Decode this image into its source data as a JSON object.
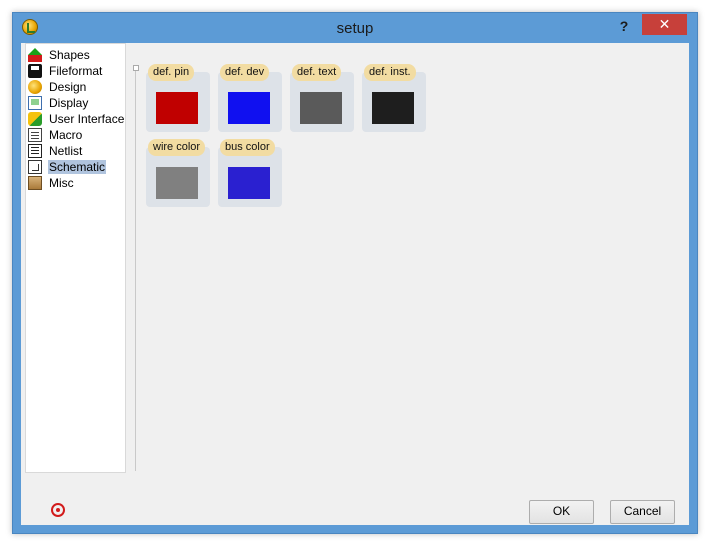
{
  "window": {
    "title": "setup",
    "help_label": "?",
    "close_label": "✕"
  },
  "sidebar": {
    "items": [
      {
        "label": "Shapes",
        "icon": "shapes-icon"
      },
      {
        "label": "Fileformat",
        "icon": "fileformat-icon"
      },
      {
        "label": "Design",
        "icon": "design-icon"
      },
      {
        "label": "Display",
        "icon": "display-icon"
      },
      {
        "label": "User Interface",
        "icon": "user-interface-icon"
      },
      {
        "label": "Macro",
        "icon": "macro-icon"
      },
      {
        "label": "Netlist",
        "icon": "netlist-icon"
      },
      {
        "label": "Schematic",
        "icon": "schematic-icon",
        "selected": true
      },
      {
        "label": "Misc",
        "icon": "misc-icon"
      }
    ]
  },
  "colors": [
    {
      "label": "def. pin",
      "color": "#c00000"
    },
    {
      "label": "def. dev",
      "color": "#1010f0"
    },
    {
      "label": "def. text",
      "color": "#5a5a5a"
    },
    {
      "label": "def. inst.",
      "color": "#1e1e1e"
    },
    {
      "label": "wire color",
      "color": "#808080"
    },
    {
      "label": "bus color",
      "color": "#2a20d0"
    }
  ],
  "footer": {
    "ok_label": "OK",
    "cancel_label": "Cancel"
  }
}
